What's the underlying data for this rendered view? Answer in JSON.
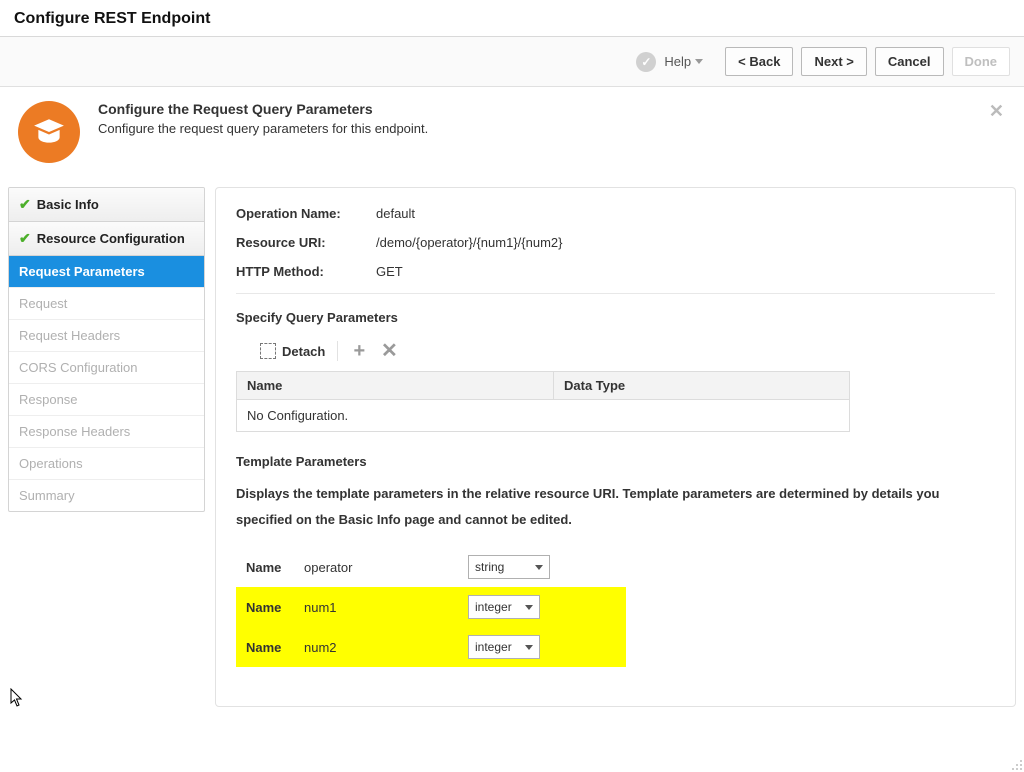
{
  "page_title": "Configure REST Endpoint",
  "topbar": {
    "help_label": "Help",
    "back_label": "< Back",
    "next_label": "Next >",
    "cancel_label": "Cancel",
    "done_label": "Done"
  },
  "banner": {
    "title": "Configure the Request Query Parameters",
    "subtitle": "Configure the request query parameters for this endpoint."
  },
  "sidebar": {
    "items": [
      {
        "label": "Basic Info",
        "state": "done"
      },
      {
        "label": "Resource Configuration",
        "state": "done"
      },
      {
        "label": "Request Parameters",
        "state": "active"
      },
      {
        "label": "Request",
        "state": "future"
      },
      {
        "label": "Request Headers",
        "state": "future"
      },
      {
        "label": "CORS Configuration",
        "state": "future"
      },
      {
        "label": "Response",
        "state": "future"
      },
      {
        "label": "Response Headers",
        "state": "future"
      },
      {
        "label": "Operations",
        "state": "future"
      },
      {
        "label": "Summary",
        "state": "future"
      }
    ]
  },
  "summary": {
    "operation_name_label": "Operation Name:",
    "operation_name_value": "default",
    "resource_uri_label": "Resource URI:",
    "resource_uri_value": "/demo/{operator}/{num1}/{num2}",
    "http_method_label": "HTTP Method:",
    "http_method_value": "GET"
  },
  "query_params": {
    "section_title": "Specify Query Parameters",
    "detach_label": "Detach",
    "col_name": "Name",
    "col_type": "Data Type",
    "empty_text": "No Configuration."
  },
  "template_params": {
    "section_title": "Template Parameters",
    "description": "Displays the template parameters in the relative resource URI. Template parameters are determined by details you specified on the Basic Info page and cannot be edited.",
    "row_label": "Name",
    "rows": [
      {
        "name": "operator",
        "type": "string",
        "highlight": false
      },
      {
        "name": "num1",
        "type": "integer",
        "highlight": true
      },
      {
        "name": "num2",
        "type": "integer",
        "highlight": true
      }
    ]
  }
}
